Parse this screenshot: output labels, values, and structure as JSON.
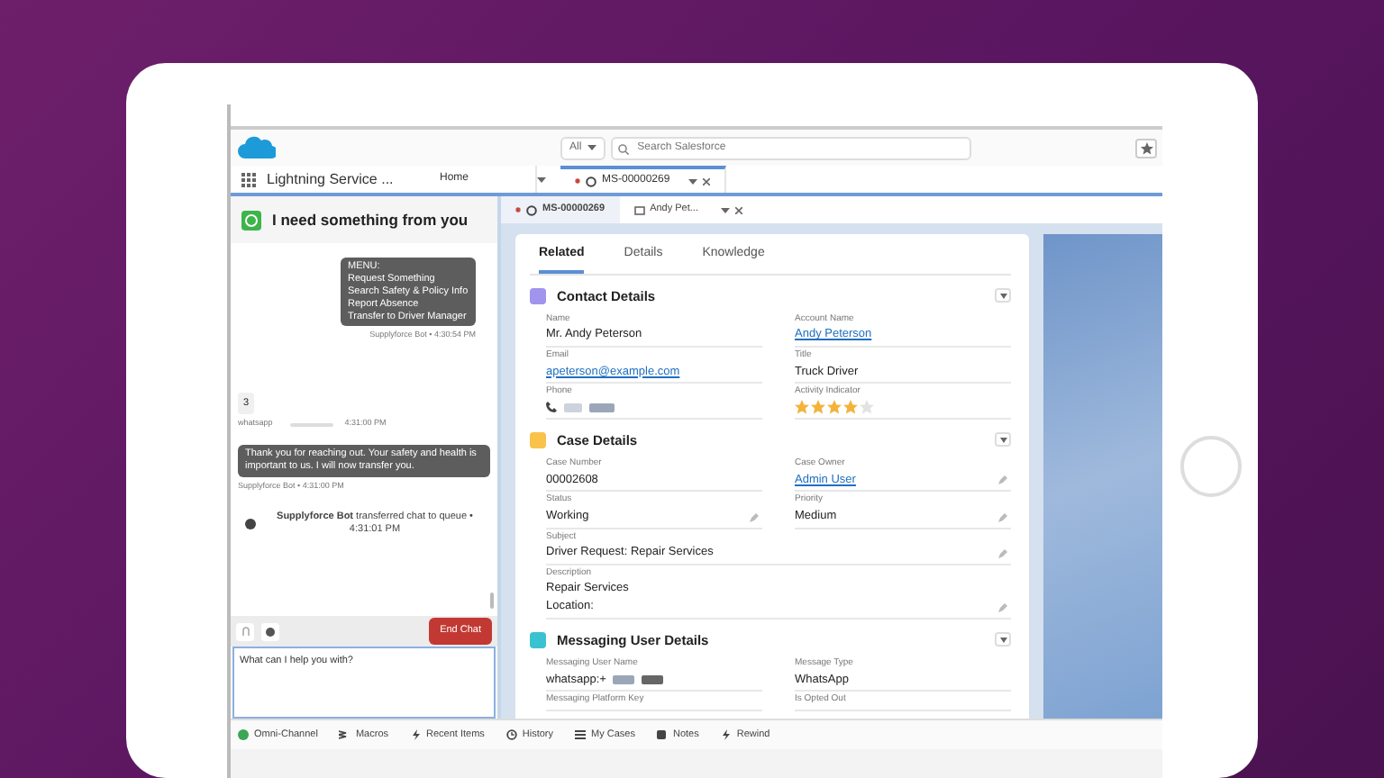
{
  "header": {
    "search_scope": "All",
    "search_placeholder": "Search Salesforce"
  },
  "nav": {
    "app_name": "Lightning Service ...",
    "tabs": [
      {
        "label": "Home",
        "selected": false,
        "unsaved": false
      },
      {
        "label": "MS-00000269",
        "selected": true,
        "unsaved": true
      }
    ]
  },
  "chat": {
    "title": "I need something from you",
    "messages": [
      {
        "kind": "bot",
        "lines": [
          "MENU:",
          "Request Something",
          "Search Safety & Policy Info",
          "Report Absence",
          "Transfer to Driver Manager"
        ],
        "meta": "Supplyforce Bot • 4:30:54 PM"
      },
      {
        "kind": "user",
        "lines": [
          "3"
        ],
        "sender": "whatsapp",
        "time": "4:31:00 PM"
      },
      {
        "kind": "bot_wide",
        "lines": [
          "Thank you for reaching out. Your safety and health is important to us. I will now transfer you."
        ],
        "meta": "Supplyforce Bot • 4:31:00 PM"
      },
      {
        "kind": "system",
        "text": "**Supplyforce Bot** transferred chat to queue • 4:31:01 PM"
      }
    ],
    "end_chat": "End Chat",
    "composer_value": "What can I help you with?"
  },
  "subtabs": [
    {
      "label": "MS-00000269",
      "selected": true,
      "unsaved": true
    },
    {
      "label": "Andy Pet...",
      "selected": false,
      "unsaved": false
    }
  ],
  "record_tabs": [
    {
      "label": "Related",
      "selected": true
    },
    {
      "label": "Details",
      "selected": false
    },
    {
      "label": "Knowledge",
      "selected": false
    }
  ],
  "sections": [
    {
      "title": "Contact Details",
      "color": "#a094ed",
      "fields": [
        {
          "label": "Name",
          "value": "Mr. Andy Peterson",
          "kind": "text",
          "editable": false,
          "wide": false
        },
        {
          "label": "Account Name",
          "value": "Andy Peterson",
          "kind": "link",
          "editable": false,
          "wide": false
        },
        {
          "label": "Email",
          "value": "apeterson@example.com",
          "kind": "link",
          "editable": false,
          "wide": false
        },
        {
          "label": "Title",
          "value": "Truck Driver",
          "kind": "text",
          "editable": false,
          "wide": false
        },
        {
          "label": "Phone",
          "kind": "phone",
          "editable": false,
          "wide": false
        },
        {
          "label": "Activity Indicator",
          "kind": "stars",
          "stars": 4,
          "editable": false,
          "wide": false
        }
      ]
    },
    {
      "title": "Case Details",
      "color": "#f9c24a",
      "fields": [
        {
          "label": "Case Number",
          "value": "00002608",
          "kind": "text",
          "editable": false,
          "wide": false
        },
        {
          "label": "Case Owner",
          "value": "Admin User",
          "kind": "link",
          "editable": true,
          "wide": false
        },
        {
          "label": "Status",
          "value": "Working",
          "kind": "text",
          "editable": true,
          "wide": false
        },
        {
          "label": "Priority",
          "value": "Medium",
          "kind": "text",
          "editable": true,
          "wide": false
        },
        {
          "label": "Subject",
          "value": "Driver Request: Repair Services",
          "kind": "text",
          "editable": true,
          "wide": true
        },
        {
          "label": "Description",
          "lines": [
            "Repair Services",
            "Location:"
          ],
          "kind": "multiline",
          "editable": true,
          "wide": true
        }
      ]
    },
    {
      "title": "Messaging User Details",
      "color": "#3bc2d0",
      "fields": [
        {
          "label": "Messaging User Name",
          "value": "whatsapp:+",
          "kind": "redacted",
          "editable": false,
          "wide": false
        },
        {
          "label": "Message Type",
          "value": "WhatsApp",
          "kind": "text",
          "editable": false,
          "wide": false
        },
        {
          "label": "Messaging Platform Key",
          "kind": "label_only",
          "editable": false,
          "wide": false
        },
        {
          "label": "Is Opted Out",
          "kind": "label_only",
          "editable": false,
          "wide": false
        }
      ]
    }
  ],
  "utility_bar": [
    {
      "label": "Omni-Channel"
    },
    {
      "label": "Macros"
    },
    {
      "label": "Recent Items"
    },
    {
      "label": "History"
    },
    {
      "label": "My Cases"
    },
    {
      "label": "Notes"
    },
    {
      "label": "Rewind"
    }
  ]
}
